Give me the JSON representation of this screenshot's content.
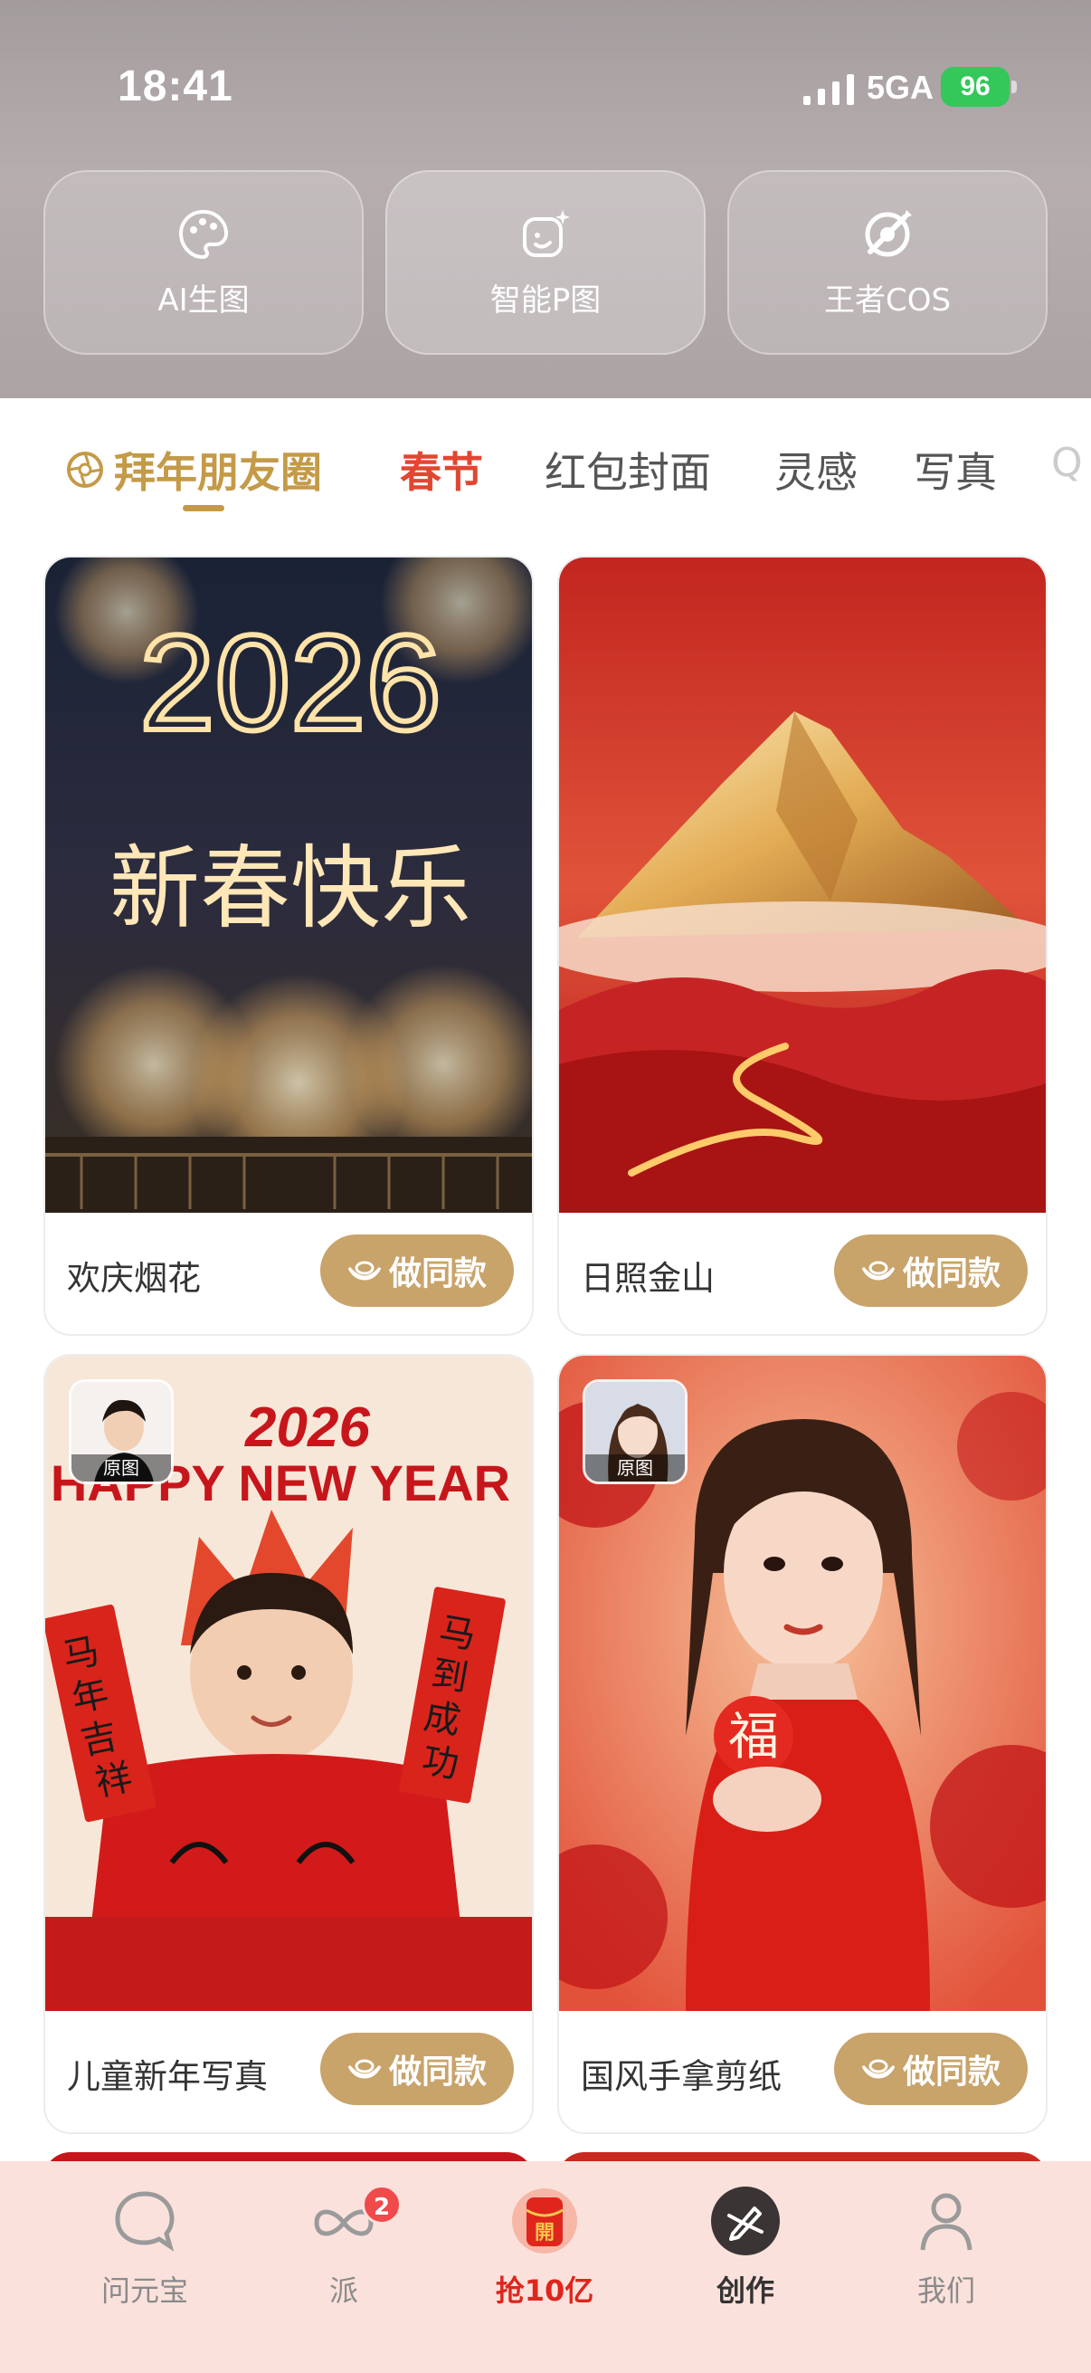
{
  "status_bar": {
    "time": "18:41",
    "network": "5GA",
    "battery": "96"
  },
  "tools": [
    {
      "label": "AI生图",
      "icon": "palette-icon"
    },
    {
      "label": "智能P图",
      "icon": "photo-magic-icon"
    },
    {
      "label": "王者COS",
      "icon": "crossed-swords-icon"
    }
  ],
  "tabs": {
    "first": "拜年朋友圈",
    "chunjie": "春节",
    "hongbao": "红包封面",
    "linggan": "灵感",
    "xiezhen": "写真",
    "more": "Q"
  },
  "cards": [
    {
      "title": "欢庆烟花",
      "button": "做同款",
      "image_text": [
        "2026",
        "新春快乐"
      ]
    },
    {
      "title": "日照金山",
      "button": "做同款"
    },
    {
      "title": "儿童新年写真",
      "button": "做同款",
      "orig_label": "原图",
      "image_text": [
        "2026",
        "HAPPY NEW YEAR",
        "马年吉祥",
        "马到成功"
      ]
    },
    {
      "title": "国风手拿剪纸",
      "button": "做同款",
      "orig_label": "原图",
      "image_text": [
        "福"
      ]
    }
  ],
  "nav": [
    {
      "label": "问元宝",
      "icon": "chat-bubble-icon"
    },
    {
      "label": "派",
      "icon": "infinity-icon",
      "badge": "2"
    },
    {
      "label": "抢10亿",
      "icon": "red-envelope-icon",
      "icon_text": "開"
    },
    {
      "label": "创作",
      "icon": "create-pen-icon"
    },
    {
      "label": "我们",
      "icon": "person-icon"
    }
  ],
  "colors": {
    "gold": "#c8a36a",
    "red_accent": "#e24630",
    "nav_bg": "#fbe1dc"
  }
}
